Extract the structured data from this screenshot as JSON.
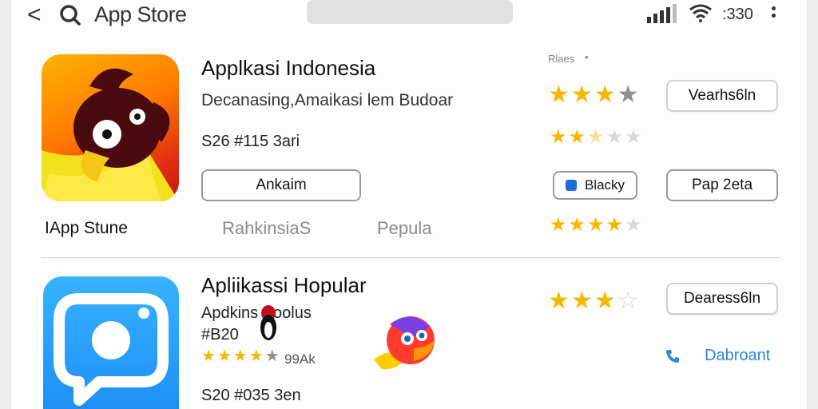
{
  "status_bar": {
    "back_glyph": "<",
    "app_name": "App Store",
    "time": ":330"
  },
  "apps": [
    {
      "title": "Applkasi Indonesia",
      "subtitle": "Decanasing,Amaikasi lem Budoar",
      "meta": "S26 #115 3ari",
      "primary_button": "Ankaim",
      "rating_label": "Rlaes",
      "rating": 4,
      "secondary_rating": 3,
      "action_button": "Vearhs6ln",
      "chip_button": "Blacky",
      "extra_button": "Pap 2eta"
    },
    {
      "title": "Apliikassi Hopular",
      "subtitle": "Apdkins  Poolus",
      "number": "#B20",
      "review_count": "99Ak",
      "meta": "S20 #035 3en",
      "rating": 3,
      "action_button": "Dearess6ln",
      "link": "Dabroant"
    }
  ],
  "section": {
    "store_label": "IApp Stune",
    "tab_1": "RahkinsiaS",
    "tab_2": "Pepula",
    "tab_rating": 4
  },
  "colors": {
    "star": "#f5b800",
    "link": "#2e86de",
    "icon_orange": "#ff7a00",
    "icon_blue": "#1f8ff5"
  },
  "icons": [
    "back-icon",
    "search-icon",
    "signal-icon",
    "wifi-icon",
    "more-icon",
    "bird-app-icon",
    "camera-chat-app-icon",
    "phone-icon"
  ]
}
